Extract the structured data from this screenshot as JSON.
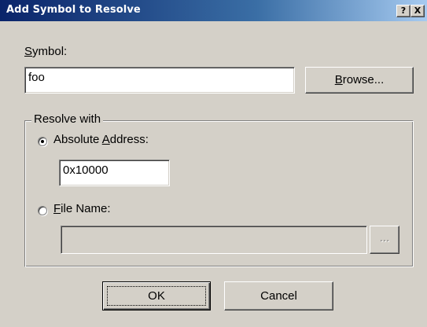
{
  "window": {
    "title": "Add Symbol to Resolve",
    "help_glyph": "?",
    "close_glyph": "X"
  },
  "symbol": {
    "label_prefix": "",
    "label_mnemonic": "S",
    "label_rest": "ymbol:",
    "value": "foo"
  },
  "browse": {
    "mnemonic": "B",
    "rest": "rowse..."
  },
  "group": {
    "legend": "Resolve with",
    "absolute": {
      "prefix": "Absolute ",
      "mnemonic": "A",
      "rest": "ddress:",
      "selected": true,
      "value": "0x10000"
    },
    "file": {
      "prefix": "",
      "mnemonic": "F",
      "rest": "ile Name:",
      "selected": false,
      "value": "",
      "browse_label": "..."
    }
  },
  "actions": {
    "ok_label": "OK",
    "cancel_label": "Cancel"
  }
}
